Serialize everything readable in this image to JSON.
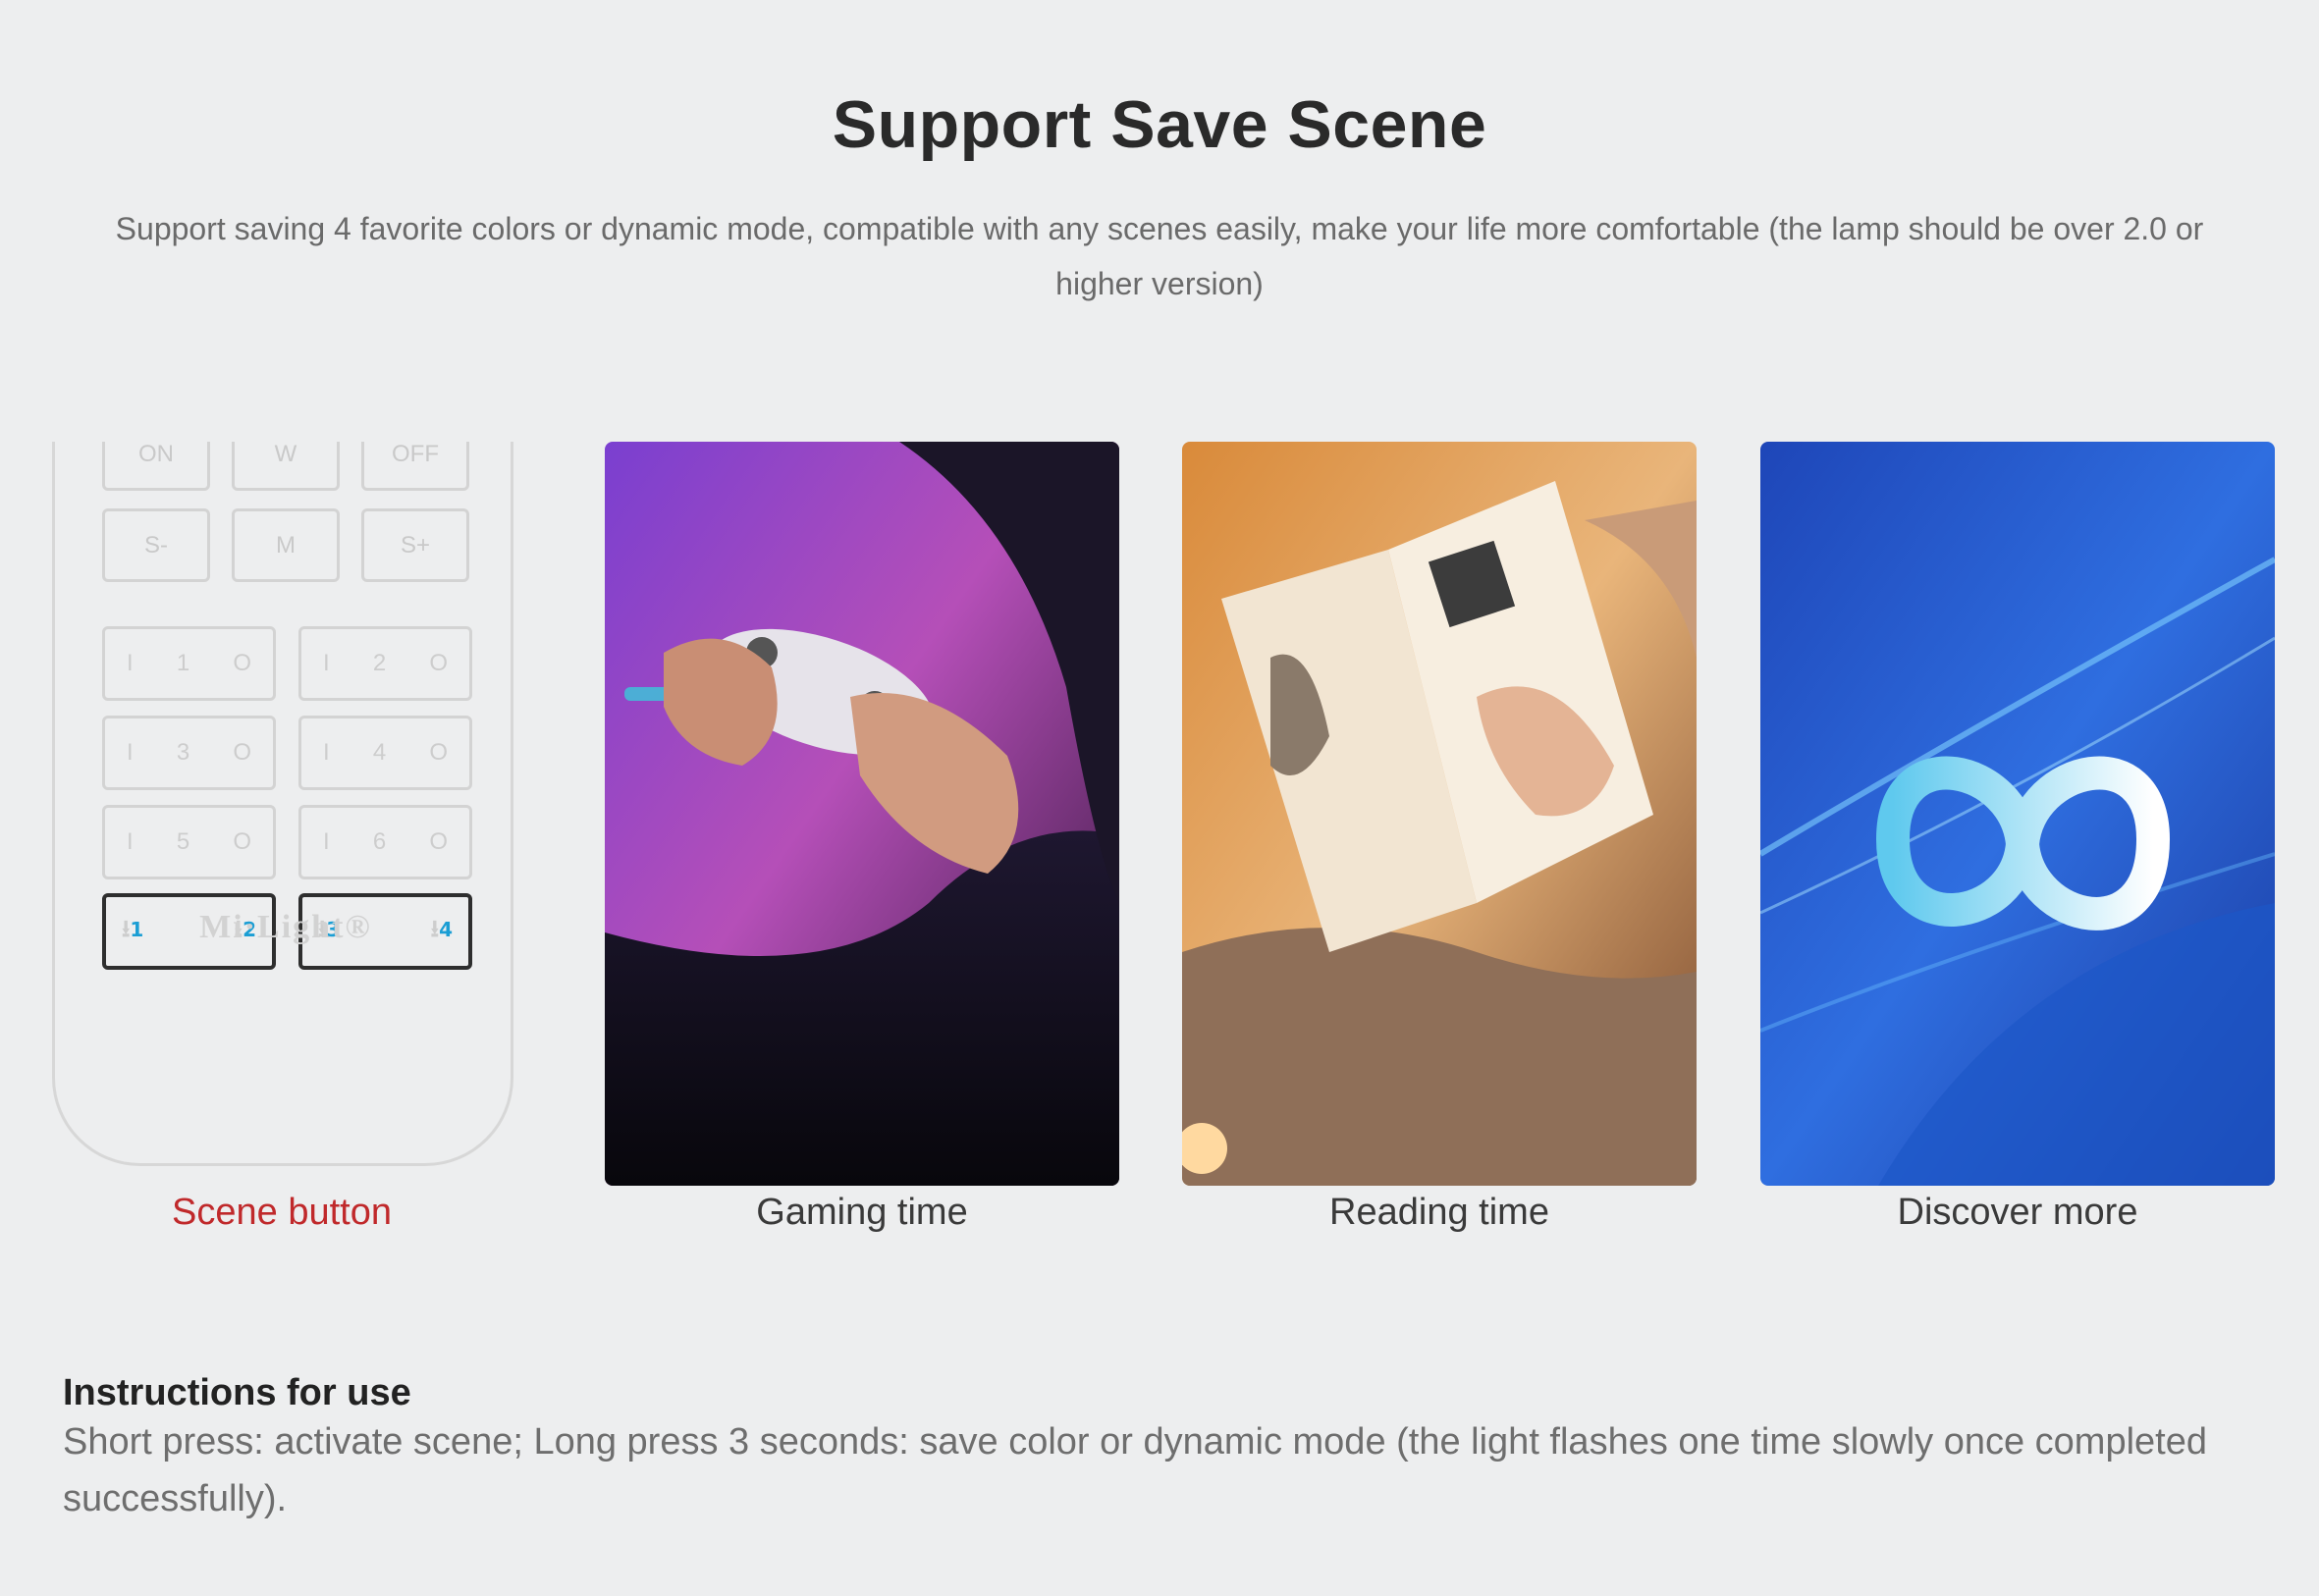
{
  "title": "Support Save Scene",
  "subtitle": "Support saving 4 favorite colors or dynamic mode, compatible with any scenes easily, make your life more comfortable (the lamp should be over 2.0 or higher version)",
  "remote": {
    "top_buttons": [
      "ON",
      "W",
      "OFF"
    ],
    "mid_buttons": [
      "S-",
      "M",
      "S+"
    ],
    "zones": [
      {
        "left": "I",
        "num": "1",
        "right": "O"
      },
      {
        "left": "I",
        "num": "2",
        "right": "O"
      },
      {
        "left": "I",
        "num": "3",
        "right": "O"
      },
      {
        "left": "I",
        "num": "4",
        "right": "O"
      },
      {
        "left": "I",
        "num": "5",
        "right": "O"
      },
      {
        "left": "I",
        "num": "6",
        "right": "O"
      }
    ],
    "scene_keys": [
      "1",
      "2",
      "3",
      "4"
    ],
    "brand": "Mi·Light®"
  },
  "captions": {
    "scene": "Scene button",
    "gaming": "Gaming time",
    "reading": "Reading time",
    "discover": "Discover more"
  },
  "instructions": {
    "heading": "Instructions for use",
    "text": "Short press: activate scene; Long press 3 seconds: save color or dynamic mode (the light flashes one time slowly once completed successfully)."
  },
  "colors": {
    "accent_red": "#c0292b",
    "scene_blue": "#1b9ed4",
    "background": "#edeeef"
  }
}
